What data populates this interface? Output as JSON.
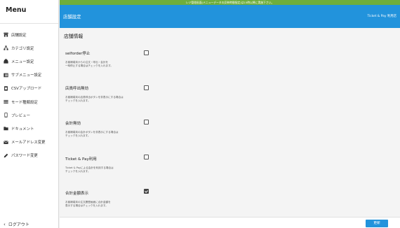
{
  "sidebar": {
    "title": "Menu",
    "items": [
      {
        "label": "店舗設定",
        "icon": "store-icon"
      },
      {
        "label": "カテゴリ設定",
        "icon": "category-icon"
      },
      {
        "label": "メニュー設定",
        "icon": "menu-icon"
      },
      {
        "label": "サブメニュー設定",
        "icon": "submenu-icon"
      },
      {
        "label": "CSVアップロード",
        "icon": "csv-file-icon"
      },
      {
        "label": "モード種類設定",
        "icon": "list-icon"
      },
      {
        "label": "プレビュー",
        "icon": "mobile-icon"
      },
      {
        "label": "ドキュメント",
        "icon": "folder-icon"
      },
      {
        "label": "メールアドレス変更",
        "icon": "envelope-icon"
      },
      {
        "label": "パスワード変更",
        "icon": "pencil-icon"
      }
    ],
    "logout_label": "ログアウト"
  },
  "notice": "レジ管理画面(メニューデータの反映時間指定)は15時以降に実施下さい。",
  "topbar": {
    "title": "店舗設定",
    "right_label": "Ticket & Pay 利用店"
  },
  "content": {
    "section_title": "店舗情報",
    "settings": [
      {
        "label": "selforder停止",
        "description": "お客様端末からの注文・呼出・会計を\n一時停止する場合はチェックを入れます。",
        "checked": false
      },
      {
        "label": "店員呼出無効",
        "description": "お客様端末の店員呼出ボタンを非表示にする場合は\nチェックを入れます。",
        "checked": false
      },
      {
        "label": "会計無効",
        "description": "お客様端末の会計ボタンを非表示にする場合は\nチェックを入れます。",
        "checked": false
      },
      {
        "label": "Ticket & Pay利用",
        "description": "Ticket & Payによる会計を利用する場合は\nチェックを入れます。",
        "checked": false
      },
      {
        "label": "合計金額表示",
        "description": "お客様端末の注文履歴画面に合計金額を\n表示する場合はチェックを入れます。",
        "checked": true
      }
    ]
  },
  "footer": {
    "update_label": "更新"
  }
}
